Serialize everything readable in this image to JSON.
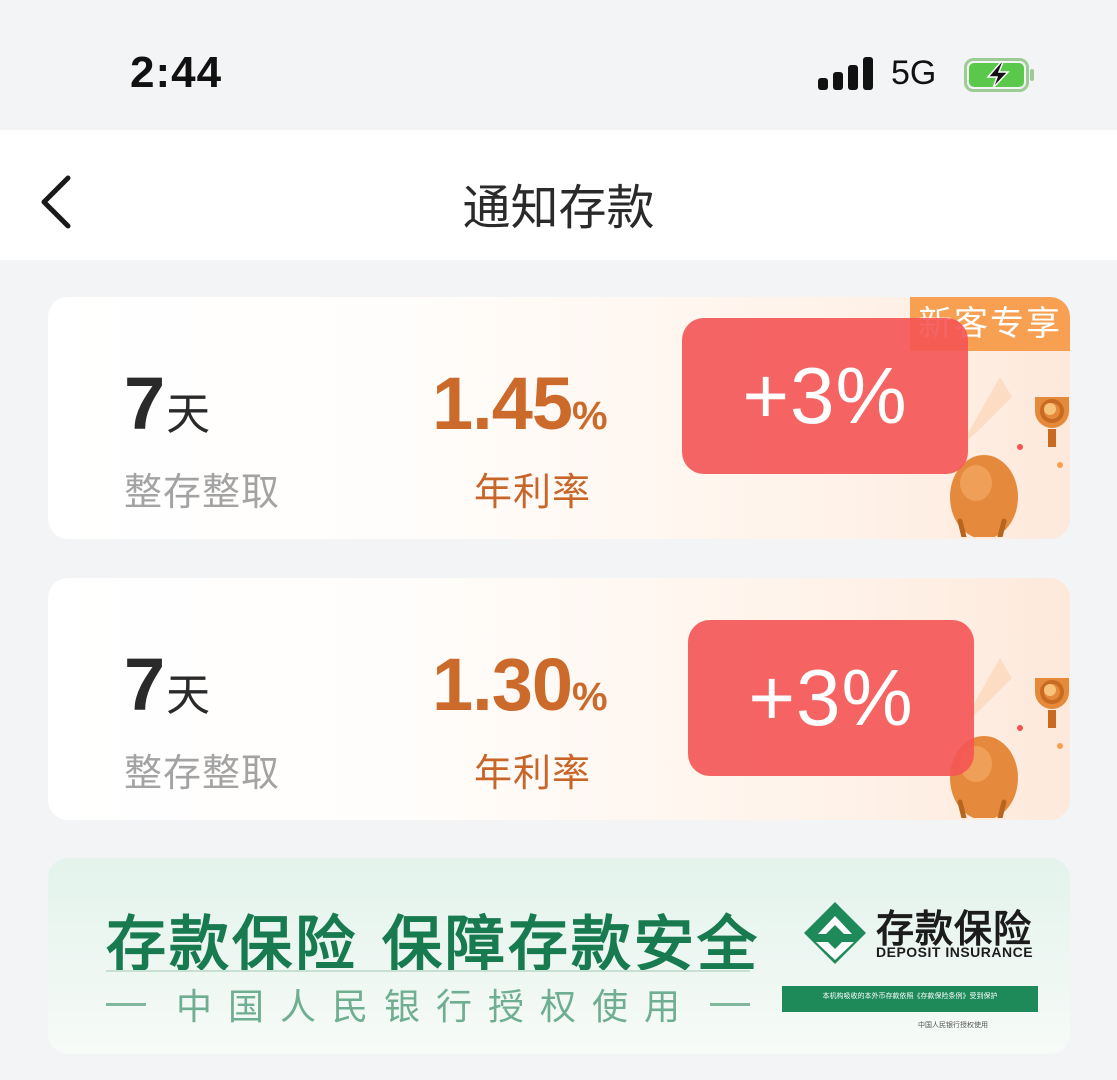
{
  "status_bar": {
    "time": "2:44",
    "network": "5G",
    "signal_bars": 4,
    "battery_charging": true
  },
  "nav": {
    "title": "通知存款"
  },
  "products": [
    {
      "term_number": "7",
      "term_unit": "天",
      "deposit_type": "整存整取",
      "rate_value": "1.45",
      "rate_percent": "%",
      "rate_label": "年利率",
      "boost": "+3%",
      "tag": "新客专享"
    },
    {
      "term_number": "7",
      "term_unit": "天",
      "deposit_type": "整存整取",
      "rate_value": "1.30",
      "rate_percent": "%",
      "rate_label": "年利率",
      "boost": "+3%"
    }
  ],
  "insurance_banner": {
    "title": "存款保险 保障存款安全",
    "subtitle": "中国人民银行授权使用",
    "logo_cn": "存款保险",
    "logo_en": "DEPOSIT INSURANCE",
    "strip_text": "本机构吸收的本外币存款依照《存款保险条例》受到保护",
    "footnote": "中国人民银行授权使用"
  },
  "colors": {
    "rate": "#cc6a2c",
    "boost": "#f45454",
    "tag": "#f7a052",
    "insurance_green": "#187a4f"
  },
  "icons": {
    "back": "chevron-left-icon",
    "mascot": "bean-trophy-mascot-icon",
    "insurance_logo": "deposit-insurance-logo-icon"
  }
}
